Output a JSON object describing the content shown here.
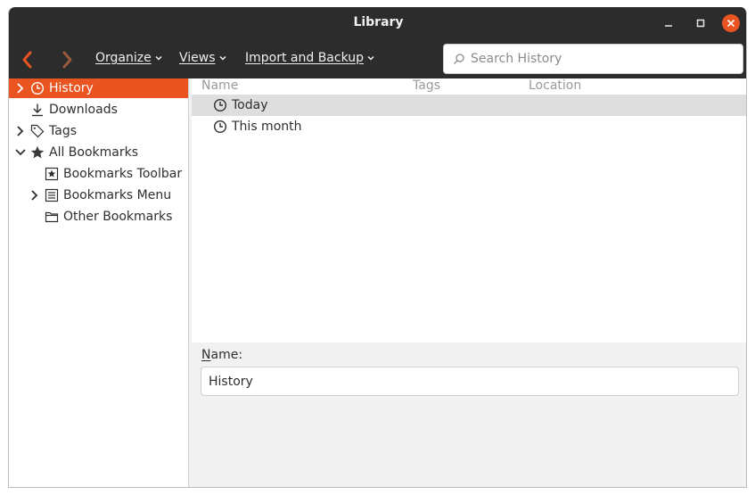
{
  "window": {
    "title": "Library"
  },
  "toolbar": {
    "organize_label": "Organize",
    "views_label": "Views",
    "import_label": "Import and Backup",
    "search_placeholder": "Search History"
  },
  "sidebar": {
    "items": [
      {
        "label": "History",
        "icon": "clock-icon",
        "selected": true
      },
      {
        "label": "Downloads",
        "icon": "download-icon"
      },
      {
        "label": "Tags",
        "icon": "tag-icon"
      },
      {
        "label": "All Bookmarks",
        "icon": "star-icon"
      },
      {
        "label": "Bookmarks Toolbar",
        "icon": "bookmarks-toolbar-icon"
      },
      {
        "label": "Bookmarks Menu",
        "icon": "bookmarks-menu-icon"
      },
      {
        "label": "Other Bookmarks",
        "icon": "folder-icon"
      }
    ]
  },
  "list": {
    "columns": [
      "Name",
      "Tags",
      "Location"
    ],
    "rows": [
      {
        "name": "Today",
        "icon": "clock-icon",
        "selected": true
      },
      {
        "name": "This month",
        "icon": "clock-icon"
      }
    ]
  },
  "details": {
    "name_label_accel": "N",
    "name_label_rest": "ame:",
    "name_value": "History"
  },
  "colors": {
    "accent": "#e95420",
    "titlebar": "#2c2c2c",
    "selected_row": "#dedede"
  }
}
